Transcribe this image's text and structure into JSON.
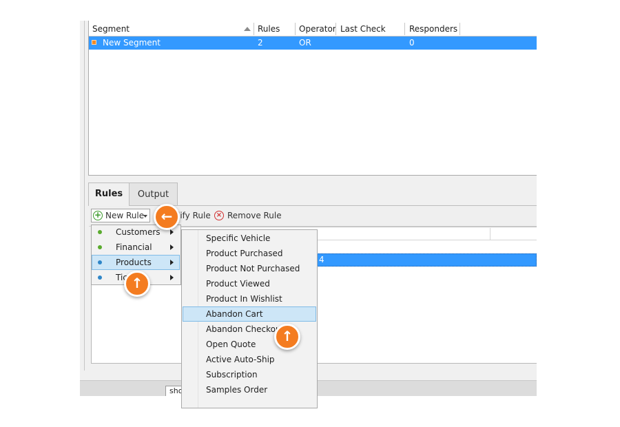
{
  "segment_grid": {
    "columns": [
      "Segment",
      "Rules",
      "Operator",
      "Last Check",
      "Responders"
    ],
    "rows": [
      {
        "segment": "New Segment",
        "rules": "2",
        "operator": "OR",
        "last_check": "",
        "responders": "0"
      }
    ]
  },
  "tabs": [
    {
      "label": "Rules",
      "active": true
    },
    {
      "label": "Output",
      "active": false
    }
  ],
  "toolbar": {
    "new_rule_label": "New Rule",
    "modify_rule_label": "lify Rule",
    "remove_rule_label": "Remove Rule"
  },
  "rules_grid": {
    "selected_row_value": "4"
  },
  "category_menu": {
    "items": [
      {
        "label": "Customers",
        "dot_color": "#5aab2e"
      },
      {
        "label": "Financial",
        "dot_color": "#5aab2e"
      },
      {
        "label": "Products",
        "dot_color": "#2f86c8",
        "selected": true
      },
      {
        "label": "Tic",
        "dot_color": "#2f86c8"
      }
    ]
  },
  "products_menu": {
    "items": [
      "Specific Vehicle",
      "Product Purchased",
      "Product Not Purchased",
      "Product Viewed",
      "Product In Wishlist",
      "Abandon Cart",
      "Abandon Checkout",
      "Open Quote",
      "Active Auto-Ship",
      "Subscription",
      "Samples Order"
    ],
    "selected": "Abandon Cart"
  },
  "status_bar": {
    "field_text": "sho"
  },
  "markers": [
    {
      "name": "left-arrow-marker",
      "glyph": "←"
    },
    {
      "name": "up-arrow-marker",
      "glyph": "↑"
    },
    {
      "name": "up-arrow-marker",
      "glyph": "↑"
    }
  ],
  "colors": {
    "selection_blue": "#3399ff",
    "menu_highlight": "#cde6f7",
    "marker_orange": "#f47c20"
  }
}
